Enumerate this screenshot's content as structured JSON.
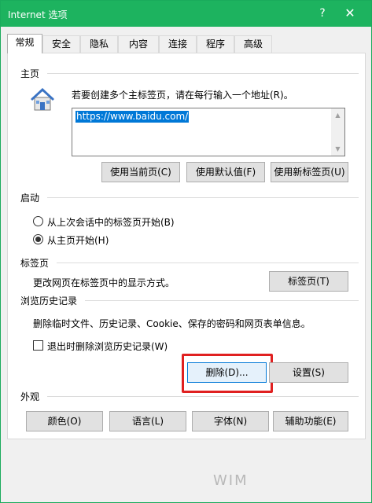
{
  "window": {
    "title": "Internet 选项",
    "help_glyph": "?",
    "close_glyph": "✕"
  },
  "tabs": [
    {
      "label": "常规",
      "active": true
    },
    {
      "label": "安全"
    },
    {
      "label": "隐私"
    },
    {
      "label": "内容"
    },
    {
      "label": "连接"
    },
    {
      "label": "程序"
    },
    {
      "label": "高级"
    }
  ],
  "home": {
    "section_title": "主页",
    "icon": "house-icon",
    "instruction": "若要创建多个主标签页，请在每行输入一个地址(R)。",
    "url_value": "https://www.baidu.com/",
    "use_current_label": "使用当前页(C)",
    "use_default_label": "使用默认值(F)",
    "use_new_tab_label": "使用新标签页(U)"
  },
  "startup": {
    "section_title": "启动",
    "option_last_session": "从上次会话中的标签页开始(B)",
    "option_home": "从主页开始(H)",
    "selected": "home"
  },
  "tabs_section": {
    "section_title": "标签页",
    "description": "更改网页在标签页中的显示方式。",
    "button_label": "标签页(T)"
  },
  "history": {
    "section_title": "浏览历史记录",
    "description": "删除临时文件、历史记录、Cookie、保存的密码和网页表单信息。",
    "delete_on_exit_label": "退出时删除浏览历史记录(W)",
    "delete_on_exit_checked": false,
    "delete_label": "删除(D)...",
    "settings_label": "设置(S)"
  },
  "appearance": {
    "section_title": "外观",
    "colors_label": "颜色(O)",
    "languages_label": "语言(L)",
    "fonts_label": "字体(N)",
    "accessibility_label": "辅助功能(E)"
  },
  "colors": {
    "titlebar": "#1db35f",
    "highlight": "#e02020",
    "selection": "#0078d7"
  },
  "watermark": "WIM"
}
